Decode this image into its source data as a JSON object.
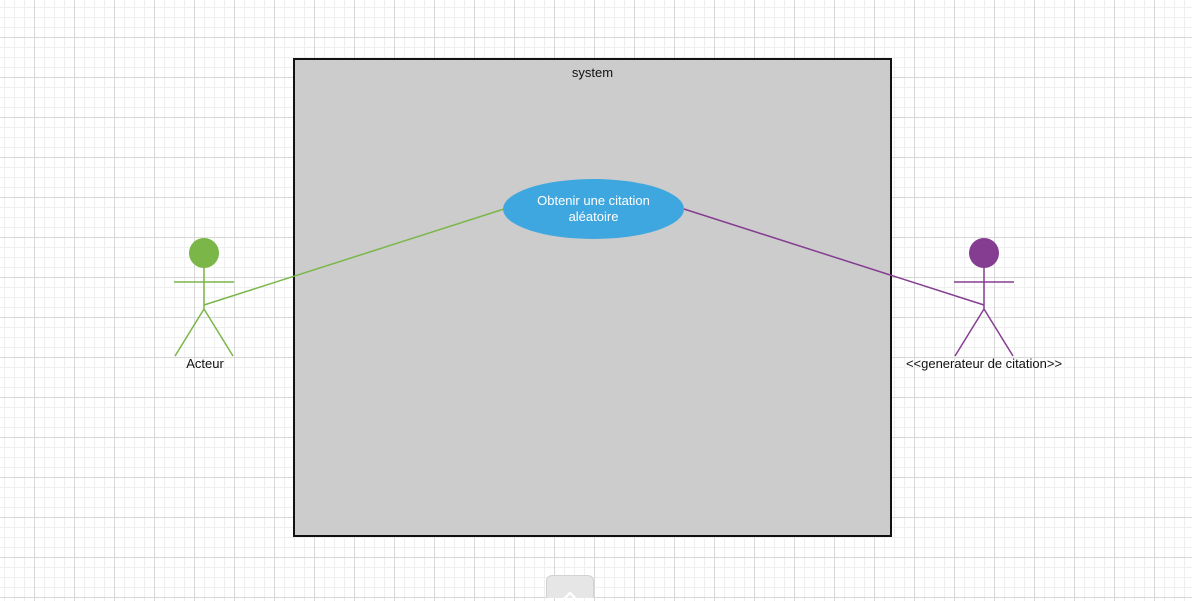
{
  "diagram": {
    "system": {
      "label": "system",
      "fill": "#cccccc",
      "stroke": "#111111"
    },
    "usecase": {
      "label": "Obtenir une citation aléatoire",
      "fill": "#3fa7df"
    },
    "actors": [
      {
        "id": "acteur",
        "label": "Acteur",
        "color": "#7ab648"
      },
      {
        "id": "generateur",
        "label": "<<generateur de citation>>",
        "color": "#853d91"
      }
    ]
  },
  "ui": {
    "collapse_icon": "chevron-up-icon"
  }
}
